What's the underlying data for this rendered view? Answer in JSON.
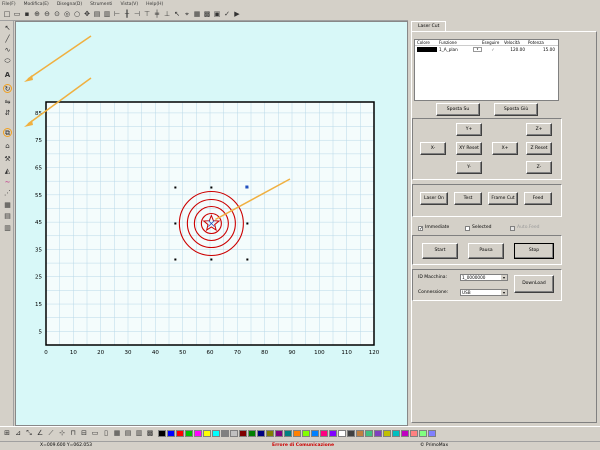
{
  "menu": {
    "items": [
      "File(F)",
      "Modifica(E)",
      "Disegna(D)",
      "Strumenti",
      "Vista(V)",
      "Help(H)"
    ]
  },
  "panel": {
    "tab_label": "Laser Cut",
    "layer_table": {
      "headers": [
        "Colore",
        "Funzione",
        "Eseguire",
        "Velocità",
        "Potenza"
      ],
      "rows": [
        {
          "color": "#000000",
          "function": "1_A_plan",
          "execute": "✓",
          "speed": "120.00",
          "power": "15.00"
        }
      ]
    },
    "move_up_label": "Sposta Su",
    "move_down_label": "Sposta Giù",
    "y_plus": "Y+",
    "z_plus": "Z+",
    "x_minus": "X-",
    "xy_reset": "XY Reset",
    "x_plus": "X+",
    "z_reset": "Z Reset",
    "y_minus": "Y-",
    "z_minus": "Z-",
    "laser_on": "Laser On",
    "test": "Test",
    "frame_cut": "Frame Cut",
    "feed": "Feed",
    "immediate_label": "Immediate",
    "selected_label": "Selected",
    "autofeed_label": "Auto.Feed",
    "start_label": "Start",
    "pause_label": "Pausa",
    "stop_label": "Stop",
    "machine_id_label": "ID Macchina:",
    "machine_id_value": "1_0000000",
    "connection_label": "Connessione:",
    "connection_value": "USB",
    "download_label": "DownLoad"
  },
  "status": {
    "coords": "X=009.600 Y=062.053",
    "error": "Errore di Comunicazione",
    "brand": "© PrimoMax"
  },
  "palette": [
    "#000000",
    "#0000ff",
    "#ff0000",
    "#00c000",
    "#ff00ff",
    "#ffff00",
    "#00ffff",
    "#808080",
    "#c0c0c0",
    "#800000",
    "#008000",
    "#000080",
    "#808000",
    "#800080",
    "#008080",
    "#ff8000",
    "#80ff00",
    "#0080ff",
    "#ff0080",
    "#8000ff",
    "#ffffff",
    "#404040",
    "#c08040",
    "#40c080",
    "#8040c0",
    "#c0c000",
    "#00c0c0",
    "#c000c0",
    "#ff8080",
    "#80ff80",
    "#8080ff"
  ],
  "canvas": {
    "x_ticks": [
      "0",
      "10",
      "20",
      "30",
      "40",
      "50",
      "60",
      "70",
      "80",
      "90",
      "100",
      "110",
      "120"
    ],
    "y_ticks": [
      "85",
      "75",
      "65",
      "55",
      "45",
      "35",
      "25",
      "15",
      "5"
    ],
    "grid_color": "#b8d8e8",
    "shape_color": "#cc0000",
    "arrow_color": "#f0b040"
  }
}
